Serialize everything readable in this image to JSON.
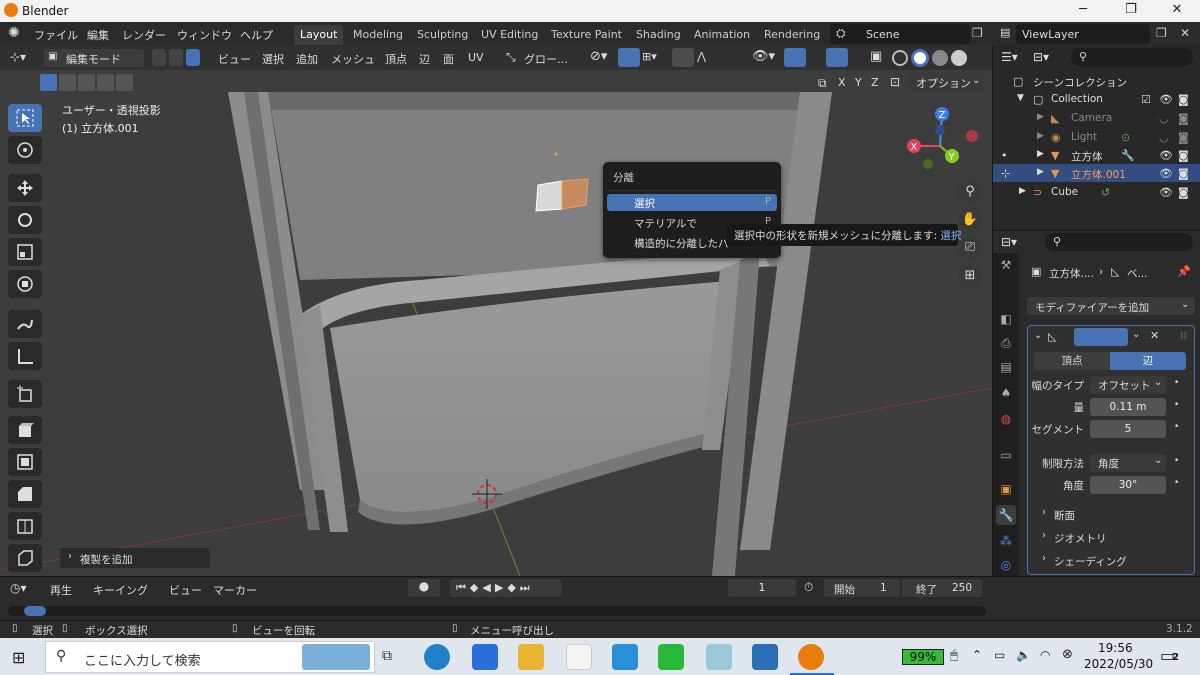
{
  "app": {
    "title": "Blender"
  },
  "menubar": {
    "menus": [
      "ファイル",
      "編集",
      "レンダー",
      "ウィンドウ",
      "ヘルプ"
    ],
    "workspaces": [
      "Layout",
      "Modeling",
      "Sculpting",
      "UV Editing",
      "Texture Paint",
      "Shading",
      "Animation",
      "Rendering"
    ],
    "scene": "Scene",
    "view_layer": "ViewLayer"
  },
  "viewport_header": {
    "mode": "編集モード",
    "menus": [
      "ビュー",
      "選択",
      "追加",
      "メッシュ",
      "頂点",
      "辺",
      "面",
      "UV"
    ],
    "transform": "グロー…",
    "options": "オプション",
    "axes": [
      "X",
      "Y",
      "Z"
    ]
  },
  "viewport": {
    "view_name": "ユーザー・透視投影",
    "object_name": "(1) 立方体.001",
    "last_op": "複製を追加",
    "gizmo_axes": {
      "x": "X",
      "y": "Y",
      "z": "Z"
    }
  },
  "context_menu": {
    "title": "分離",
    "items": [
      {
        "label": "選択",
        "shortcut": "P"
      },
      {
        "label": "マテリアルで",
        "shortcut": "P"
      },
      {
        "label": "構造的に分離したパ",
        "shortcut": ""
      }
    ]
  },
  "tooltip": {
    "text": "選択中の形状を新規メッシュに分離します:",
    "highlight": "選択"
  },
  "outliner": {
    "root": "シーンコレクション",
    "collection": "Collection",
    "items": [
      {
        "label": "Camera",
        "selected": false
      },
      {
        "label": "Light",
        "selected": false
      },
      {
        "label": "立方体",
        "selected": false
      },
      {
        "label": "立方体.001",
        "selected": true
      },
      {
        "label": "Cube",
        "selected": false
      }
    ]
  },
  "properties": {
    "breadcrumb_obj": "立方体....",
    "breadcrumb_mod": "ベ...",
    "add_modifier": "モディファイアーを追加",
    "tabs": {
      "vertex": "頂点",
      "edge": "辺"
    },
    "width_type_label": "幅のタイプ",
    "width_type": "オフセット",
    "amount_label": "量",
    "amount": "0.11 m",
    "segments_label": "セグメント",
    "segments": "5",
    "limit_label": "制限方法",
    "limit": "角度",
    "angle_label": "角度",
    "angle": "30°",
    "panels": [
      "断面",
      "ジオメトリ",
      "シェーディング"
    ]
  },
  "timeline": {
    "menus": [
      "再生",
      "キーイング",
      "ビュー",
      "マーカー"
    ],
    "current_frame": "1",
    "start_label": "開始",
    "start": "1",
    "end_label": "終了",
    "end": "250"
  },
  "statusbar": {
    "items": [
      "選択",
      "ボックス選択",
      "ビューを回転",
      "メニュー呼び出し"
    ],
    "version": "3.1.2"
  },
  "taskbar": {
    "search_placeholder": "ここに入力して検索",
    "battery": "99%",
    "time": "19:56",
    "date": "2022/05/30",
    "notifications": "2"
  }
}
